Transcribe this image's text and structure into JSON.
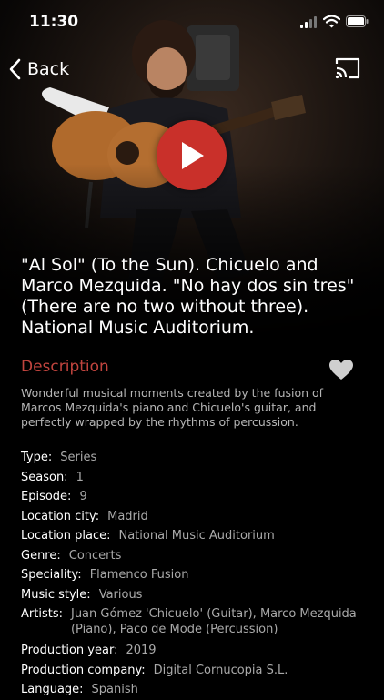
{
  "status_bar": {
    "time": "11:30"
  },
  "nav": {
    "back_label": "Back"
  },
  "title": "\"Al Sol\" (To the Sun). Chicuelo and Marco Mezquida. \"No hay dos sin tres\" (There are no two without three). National Music Auditorium.",
  "description": {
    "heading": "Description",
    "text": "Wonderful musical moments created by the fusion of Marcos Mezquida's piano and Chicuelo's guitar, and perfectly wrapped by the rhythms of percussion."
  },
  "details": [
    {
      "label": "Type:",
      "value": "Series"
    },
    {
      "label": "Season:",
      "value": "1"
    },
    {
      "label": "Episode:",
      "value": "9"
    },
    {
      "label": "Location city:",
      "value": "Madrid"
    },
    {
      "label": "Location place:",
      "value": "National Music Auditorium"
    },
    {
      "label": "Genre:",
      "value": "Concerts"
    },
    {
      "label": "Speciality:",
      "value": "Flamenco Fusion"
    },
    {
      "label": "Music style:",
      "value": "Various"
    },
    {
      "label": "Artists:",
      "value": "Juan Gómez 'Chicuelo' (Guitar), Marco Mezquida (Piano), Paco de Mode (Percussion)"
    },
    {
      "label": "Production year:",
      "value": "2019"
    },
    {
      "label": "Production company:",
      "value": "Digital Cornucopia S.L."
    },
    {
      "label": "Language:",
      "value": "Spanish"
    }
  ],
  "colors": {
    "accent": "#c0443e",
    "play_button": "#c9302a",
    "background": "#000000"
  },
  "icons": [
    "back-chevron-icon",
    "cast-icon",
    "play-icon",
    "heart-icon",
    "signal-icon",
    "wifi-icon",
    "battery-icon"
  ]
}
